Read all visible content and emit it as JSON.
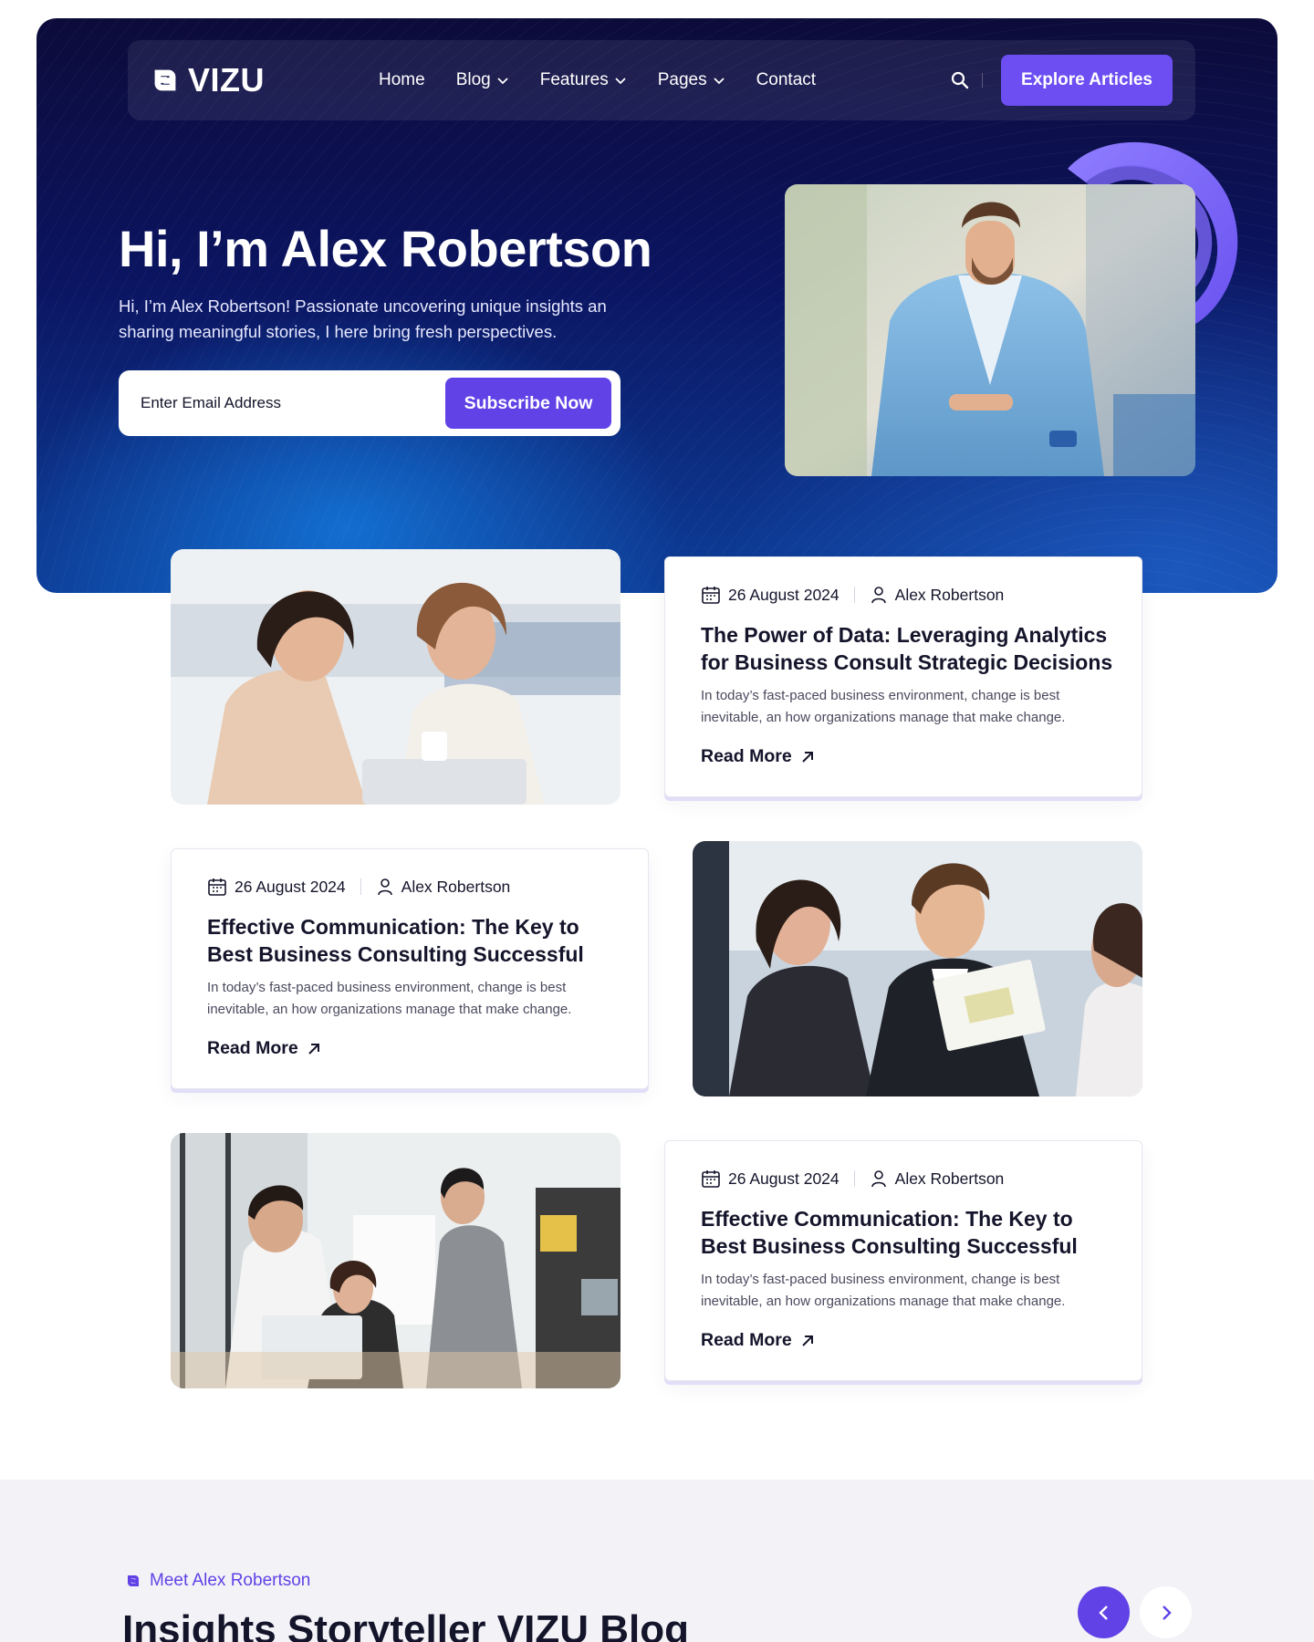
{
  "brand": {
    "name": "VIZU"
  },
  "nav": {
    "items": [
      {
        "label": "Home",
        "dropdown": false
      },
      {
        "label": "Blog",
        "dropdown": true
      },
      {
        "label": "Features",
        "dropdown": true
      },
      {
        "label": "Pages",
        "dropdown": true
      },
      {
        "label": "Contact",
        "dropdown": false
      }
    ],
    "search_icon": "search-icon",
    "cta_label": "Explore Articles"
  },
  "hero": {
    "title": "Hi, I’m Alex Robertson",
    "subtitle": "Hi, I’m Alex Robertson! Passionate uncovering unique insights an sharing meaningful stories, I here bring fresh perspectives.",
    "email_placeholder": "Enter Email Address",
    "subscribe_label": "Subscribe Now"
  },
  "posts": [
    {
      "date": "26 August 2024",
      "author": "Alex Robertson",
      "title": "The Power of Data: Leveraging Analytics for Business Consult Strategic Decisions",
      "excerpt": "In today’s fast-paced business environment, change is best inevitable, an how organizations manage that make change.",
      "read_more": "Read More"
    },
    {
      "date": "26 August 2024",
      "author": "Alex Robertson",
      "title": "Effective Communication: The Key to Best Business Consulting Successful",
      "excerpt": "In today’s fast-paced business environment, change is best inevitable, an how organizations manage that make change.",
      "read_more": "Read More"
    },
    {
      "date": "26 August 2024",
      "author": "Alex Robertson",
      "title": "Effective Communication: The Key to Best Business Consulting Successful",
      "excerpt": "In today’s fast-paced business environment, change is best inevitable, an how organizations manage that make change.",
      "read_more": "Read More"
    }
  ],
  "meet": {
    "tag": "Meet Alex Robertson",
    "title": "Insights Storyteller VIZU Blog"
  },
  "colors": {
    "accent": "#6042e6",
    "hero_dark": "#0b1460",
    "hero_blue": "#0d3f9a",
    "text": "#14142b"
  }
}
